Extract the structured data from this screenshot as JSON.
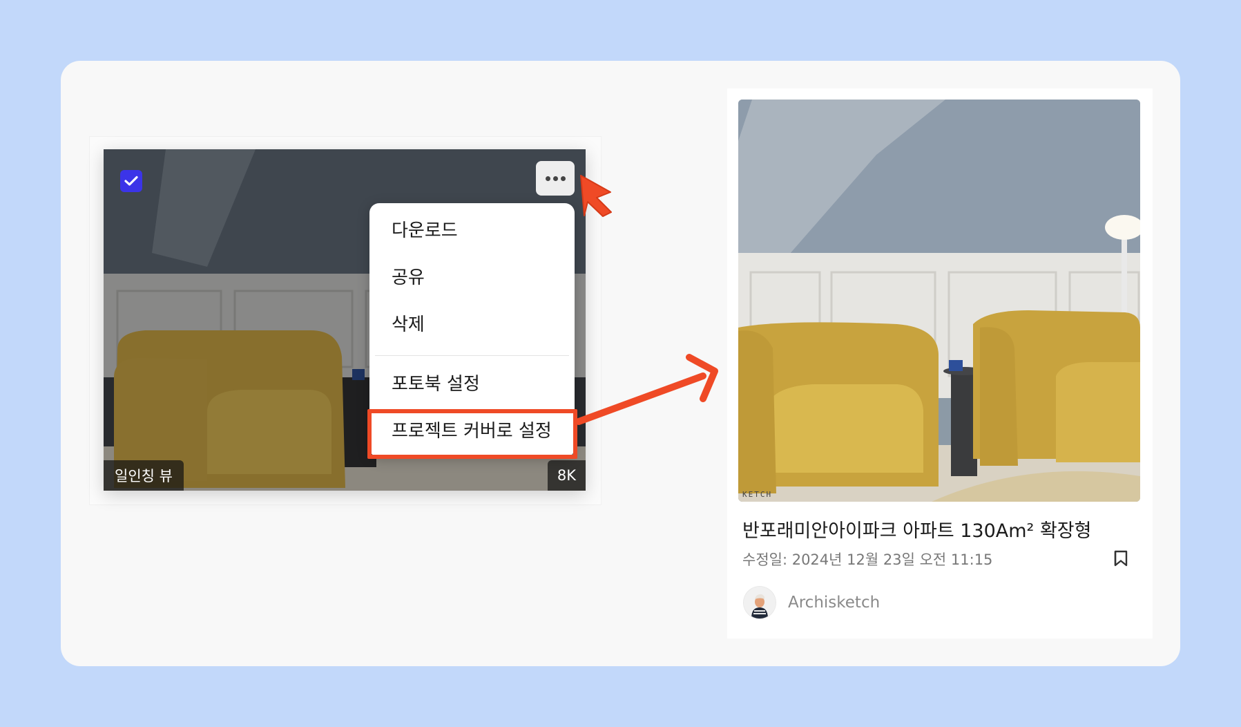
{
  "left_card": {
    "view_tag": "일인칭 뷰",
    "resolution_tag": "8K",
    "selected": true,
    "menu": {
      "items": [
        "다운로드",
        "공유",
        "삭제",
        "포토북 설정",
        "프로젝트 커버로 설정"
      ],
      "highlighted_item": "프로젝트 커버로 설정"
    }
  },
  "right_card": {
    "title": "반포래미안아이파크 아파트 130Am² 확장형",
    "modified": "수정일: 2024년 12월 23일 오전 11:15",
    "author": "Archisketch",
    "watermark": "KETCH"
  },
  "colors": {
    "background": "#c2d8fa",
    "panel": "#f8f8f8",
    "accent_annotation": "#ef4a26",
    "checkbox": "#3b34e8"
  },
  "icons": [
    "check-icon",
    "more-horizontal-icon",
    "bookmark-icon",
    "cursor-arrow-icon",
    "pointer-arrow-icon"
  ]
}
